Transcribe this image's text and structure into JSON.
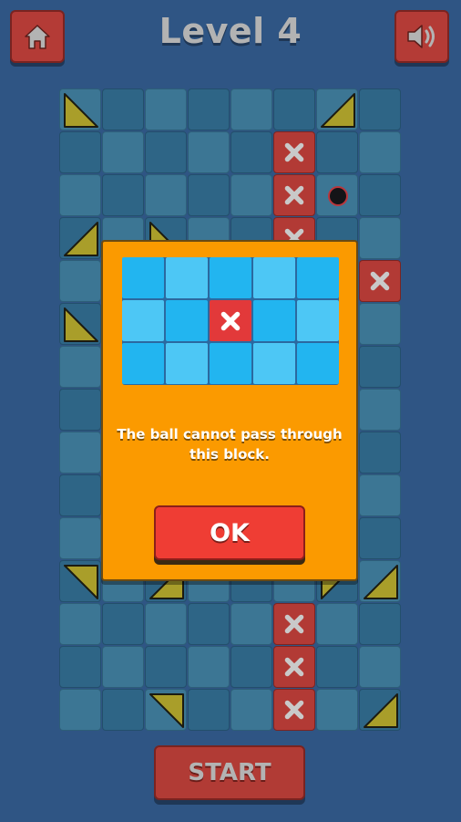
{
  "header": {
    "title": "Level 4",
    "home_icon": "home-icon",
    "sound_icon": "speaker-icon"
  },
  "board": {
    "cols": 8,
    "rows": 15,
    "blocks": [
      [
        5,
        1
      ],
      [
        5,
        2
      ],
      [
        5,
        3
      ],
      [
        7,
        4
      ],
      [
        5,
        12
      ],
      [
        5,
        13
      ],
      [
        5,
        14
      ]
    ],
    "mirrors": [
      {
        "col": 0,
        "row": 0,
        "corner": "bl"
      },
      {
        "col": 6,
        "row": 0,
        "corner": "br"
      },
      {
        "col": 0,
        "row": 3,
        "corner": "br"
      },
      {
        "col": 2,
        "row": 3,
        "corner": "bl"
      },
      {
        "col": 0,
        "row": 5,
        "corner": "bl"
      },
      {
        "col": 0,
        "row": 11,
        "corner": "tr"
      },
      {
        "col": 2,
        "row": 11,
        "corner": "br"
      },
      {
        "col": 6,
        "row": 11,
        "corner": "tl"
      },
      {
        "col": 7,
        "row": 11,
        "corner": "br"
      },
      {
        "col": 2,
        "row": 14,
        "corner": "tr"
      },
      {
        "col": 7,
        "row": 14,
        "corner": "br"
      }
    ],
    "ball": {
      "col": 6,
      "row": 2
    },
    "colors": {
      "tile": "#3c7694",
      "tile_dark": "#2e6586",
      "block": "#b23a35",
      "mirror": "#a99e2a"
    }
  },
  "dialog": {
    "message": "The ball cannot pass through\nthis block.",
    "ok_label": "OK",
    "demo_highlight": [
      2,
      1
    ]
  },
  "footer": {
    "start_label": "START"
  }
}
